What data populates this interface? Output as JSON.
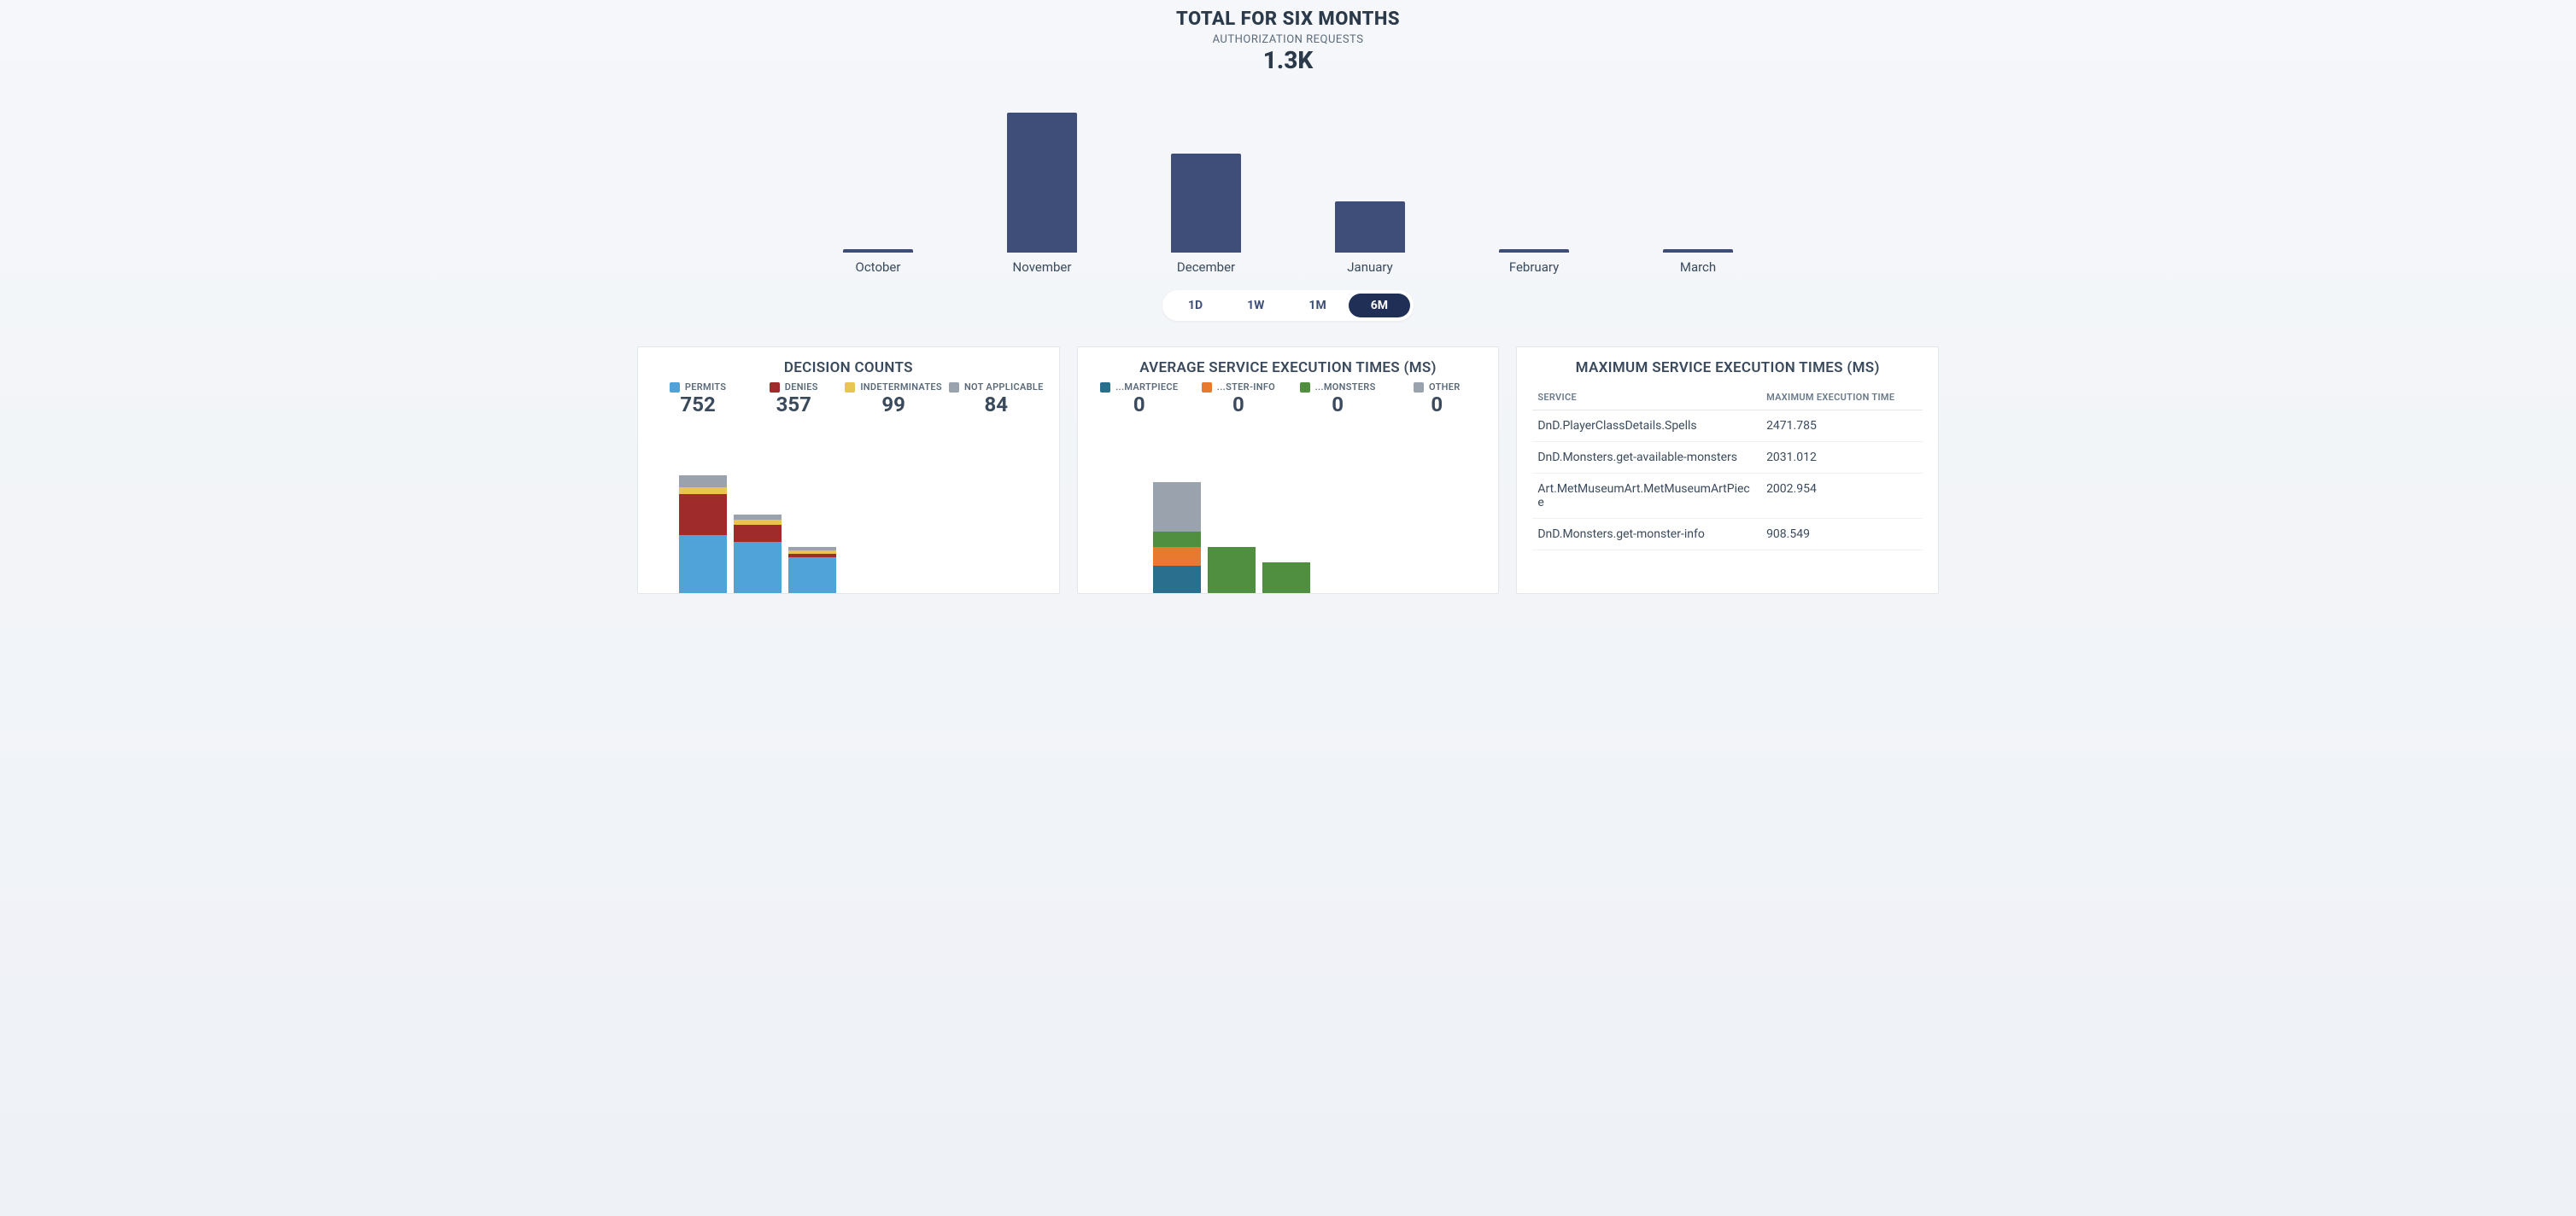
{
  "header": {
    "title": "TOTAL FOR SIX MONTHS",
    "subtitle": "AUTHORIZATION REQUESTS",
    "total": "1.3K"
  },
  "range": {
    "options": [
      "1D",
      "1W",
      "1M",
      "6M"
    ],
    "selected": "6M"
  },
  "chart_data": {
    "type": "bar",
    "title": "TOTAL FOR SIX MONTHS",
    "ylabel": "Authorization Requests",
    "categories": [
      "October",
      "November",
      "December",
      "January",
      "February",
      "March"
    ],
    "values": [
      15,
      620,
      440,
      225,
      15,
      15
    ],
    "ylim": [
      0,
      650
    ]
  },
  "decision": {
    "title": "DECISION COUNTS",
    "legend": [
      {
        "label": "PERMITS",
        "value": "752",
        "color": "#4fa3d9"
      },
      {
        "label": "DENIES",
        "value": "357",
        "color": "#a02b2b"
      },
      {
        "label": "INDETERMINATES",
        "value": "99",
        "color": "#e8c550"
      },
      {
        "label": "NOT APPLICABLE",
        "value": "84",
        "color": "#9aa3ad"
      }
    ],
    "chart": {
      "type": "bar_stacked",
      "series_names": [
        "PERMITS",
        "DENIES",
        "INDETERMINATES",
        "NOT APPLICABLE"
      ],
      "bars": [
        {
          "permits": 68,
          "denies": 48,
          "indeterminates": 8,
          "not_applicable": 14
        },
        {
          "permits": 60,
          "denies": 20,
          "indeterminates": 6,
          "not_applicable": 6
        },
        {
          "permits": 42,
          "denies": 4,
          "indeterminates": 4,
          "not_applicable": 4
        }
      ]
    }
  },
  "avgexec": {
    "title": "AVERAGE SERVICE EXECUTION TIMES (MS)",
    "legend": [
      {
        "label": "...MARTPIECE",
        "value": "0",
        "color": "#2b6f8f"
      },
      {
        "label": "...STER-INFO",
        "value": "0",
        "color": "#e77a2f"
      },
      {
        "label": "...MONSTERS",
        "value": "0",
        "color": "#4f8f3f"
      },
      {
        "label": "OTHER",
        "value": "0",
        "color": "#9aa3ad"
      }
    ],
    "chart": {
      "type": "bar_stacked",
      "bars": [
        {
          "teal": 32,
          "orange": 22,
          "green": 18,
          "grey": 58
        },
        {
          "teal": 0,
          "orange": 0,
          "green": 54,
          "grey": 0
        },
        {
          "teal": 0,
          "orange": 0,
          "green": 36,
          "grey": 0
        }
      ]
    }
  },
  "maxexec": {
    "title": "MAXIMUM SERVICE EXECUTION TIMES (MS)",
    "columns": [
      "SERVICE",
      "MAXIMUM EXECUTION TIME"
    ],
    "rows": [
      {
        "service": "DnD.PlayerClassDetails.Spells",
        "time": "2471.785"
      },
      {
        "service": "DnD.Monsters.get-available-monsters",
        "time": "2031.012"
      },
      {
        "service": "Art.MetMuseumArt.MetMuseumArtPiece",
        "time": "2002.954"
      },
      {
        "service": "DnD.Monsters.get-monster-info",
        "time": "908.549"
      }
    ]
  }
}
